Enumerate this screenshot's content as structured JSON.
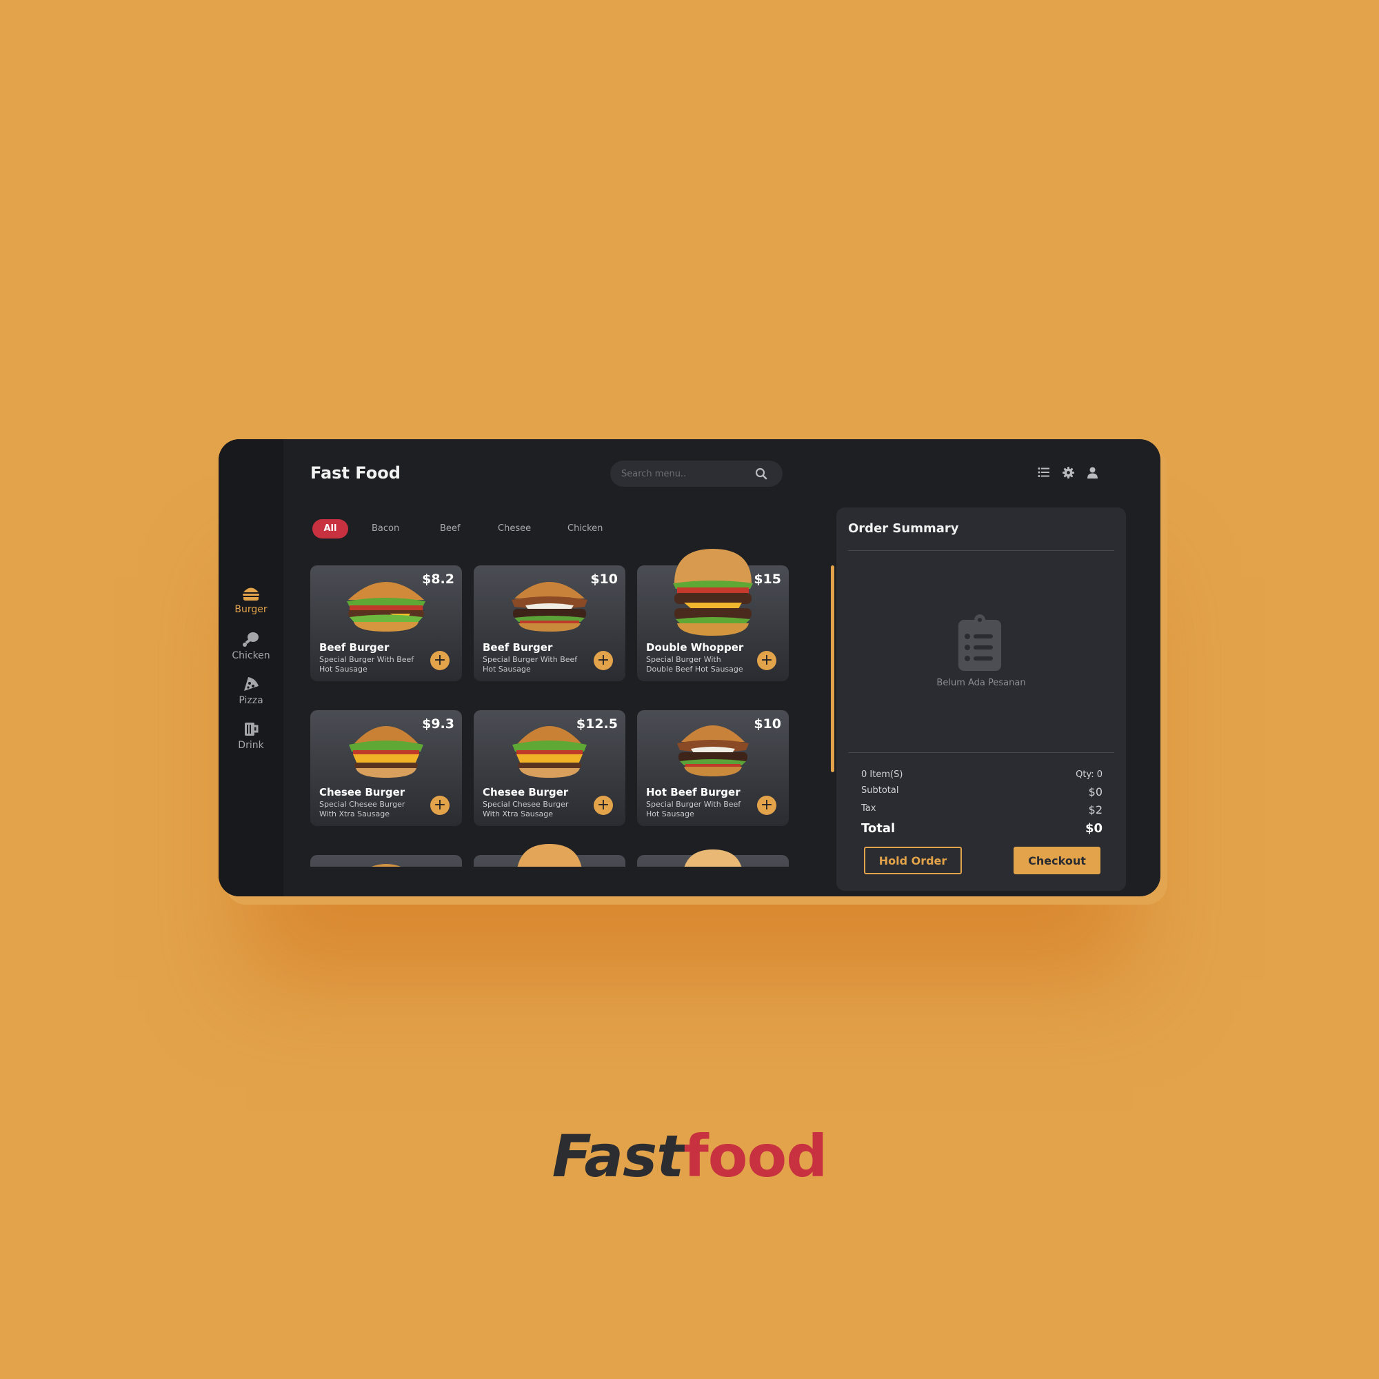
{
  "app": {
    "title": "Fast Food"
  },
  "search": {
    "placeholder": "Search menu.."
  },
  "sidebar": {
    "items": [
      {
        "label": "Burger",
        "icon": "burger-icon",
        "active": true
      },
      {
        "label": "Chicken",
        "icon": "drumstick-icon",
        "active": false
      },
      {
        "label": "Pizza",
        "icon": "pizza-icon",
        "active": false
      },
      {
        "label": "Drink",
        "icon": "mug-icon",
        "active": false
      }
    ]
  },
  "header_icons": [
    "list-icon",
    "gear-icon",
    "user-icon"
  ],
  "filters": [
    {
      "label": "All",
      "active": true
    },
    {
      "label": "Bacon",
      "active": false
    },
    {
      "label": "Beef",
      "active": false
    },
    {
      "label": "Chesee",
      "active": false
    },
    {
      "label": "Chicken",
      "active": false
    }
  ],
  "products": [
    {
      "name": "Beef Burger",
      "desc": "Special Burger With Beef Hot Sausage",
      "price": "$8.2"
    },
    {
      "name": "Beef Burger",
      "desc": "Special Burger With Beef Hot Sausage",
      "price": "$10"
    },
    {
      "name": "Double Whopper",
      "desc": "Special Burger With Double Beef Hot Sausage",
      "price": "$15"
    },
    {
      "name": "Chesee Burger",
      "desc": "Special Chesee Burger With Xtra Sausage",
      "price": "$9.3"
    },
    {
      "name": "Chesee Burger",
      "desc": "Special Chesee Burger With Xtra Sausage",
      "price": "$12.5"
    },
    {
      "name": "Hot Beef Burger",
      "desc": "Special Burger With Beef Hot Sausage",
      "price": "$10"
    }
  ],
  "add_label": "+",
  "order": {
    "title": "Order Summary",
    "empty_text": "Belum Ada Pesanan",
    "items_label": "0 Item(S)",
    "qty_label": "Qty: 0",
    "subtotal_label": "Subtotal",
    "subtotal_value": "$0",
    "tax_label": "Tax",
    "tax_value": "$2",
    "total_label": "Total",
    "total_value": "$0",
    "hold_label": "Hold Order",
    "checkout_label": "Checkout"
  },
  "brand": {
    "part1": "Fast",
    "part2": "food"
  },
  "colors": {
    "accent": "#E2A34B",
    "brand_red": "#C8313F",
    "panel": "#1E1F23",
    "background": "#E2A34B"
  }
}
